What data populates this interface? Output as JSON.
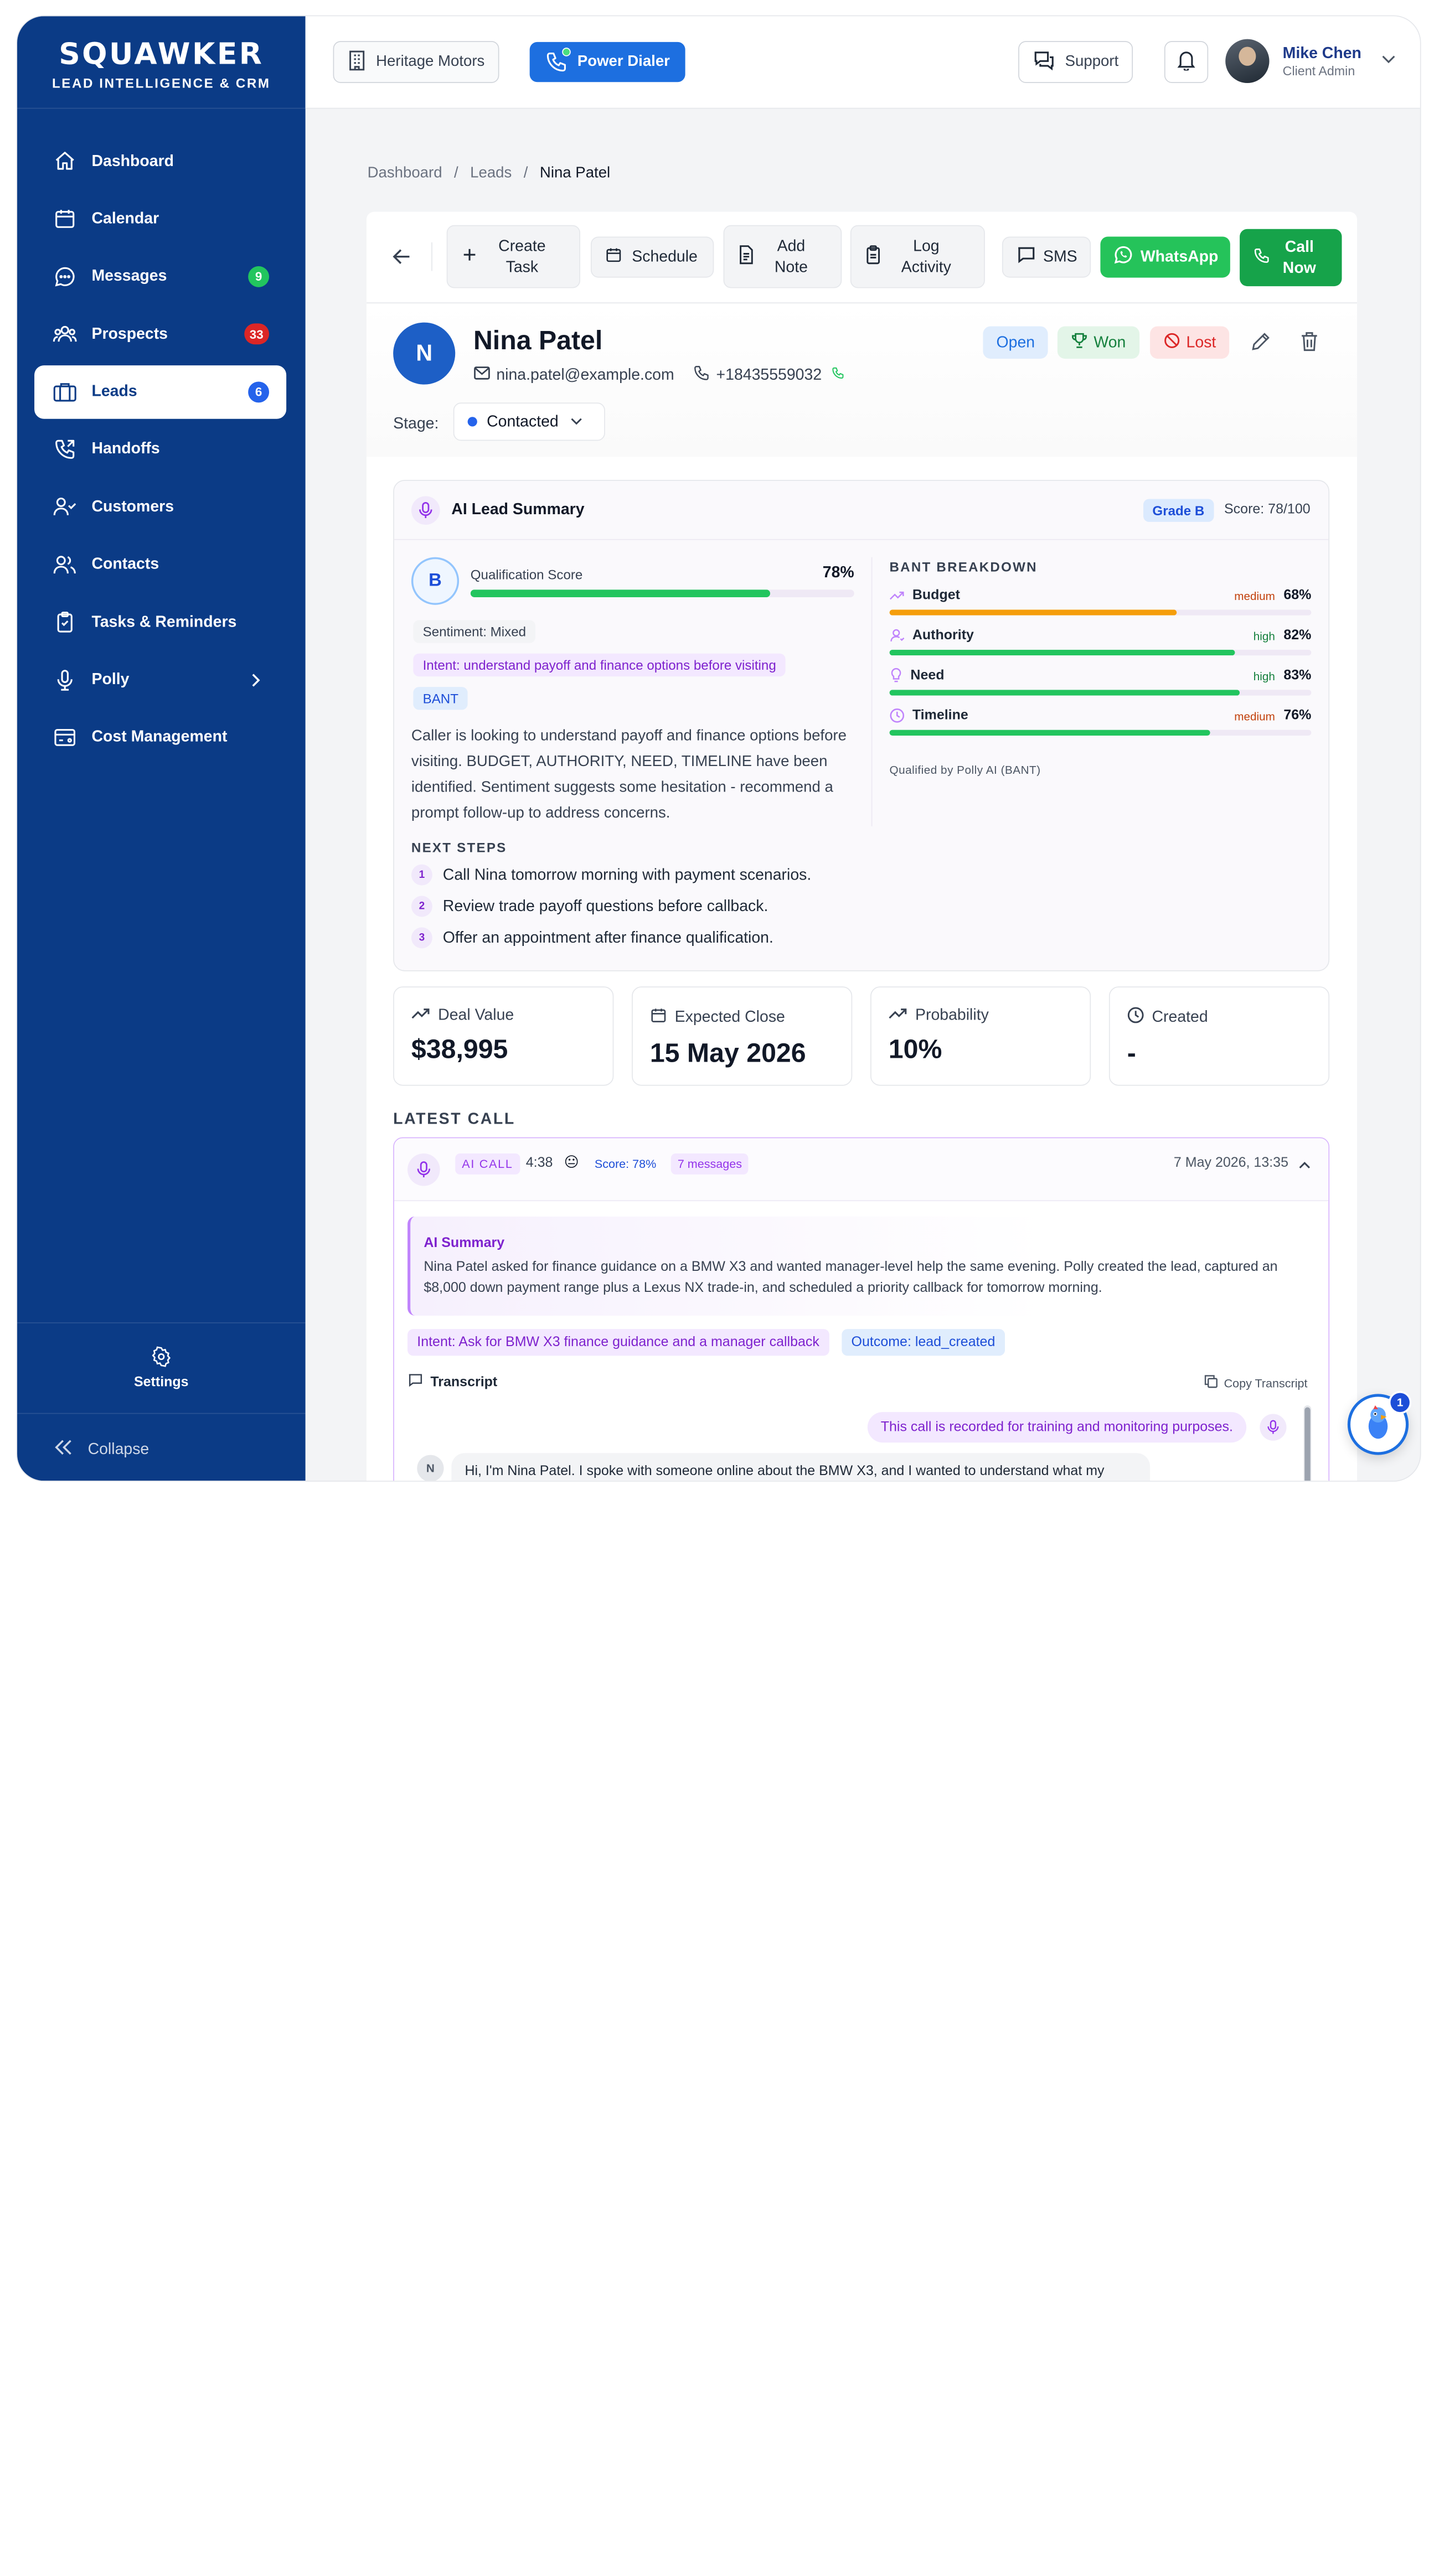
{
  "brand": {
    "title": "SQUAWKER",
    "subtitle": "LEAD INTELLIGENCE & CRM"
  },
  "sidebar": {
    "items": [
      {
        "label": "Dashboard",
        "icon": "home-icon"
      },
      {
        "label": "Calendar",
        "icon": "calendar-icon"
      },
      {
        "label": "Messages",
        "icon": "chat-icon",
        "badge": "9",
        "badge_color": "#22c55e"
      },
      {
        "label": "Prospects",
        "icon": "users-group-icon",
        "badge": "33",
        "badge_color": "#dc2626"
      },
      {
        "label": "Leads",
        "icon": "briefcase-icon",
        "badge": "6",
        "badge_color": "#2563eb",
        "active": true
      },
      {
        "label": "Handoffs",
        "icon": "phone-forward-icon"
      },
      {
        "label": "Customers",
        "icon": "user-check-icon"
      },
      {
        "label": "Contacts",
        "icon": "users-icon"
      },
      {
        "label": "Tasks & Reminders",
        "icon": "clipboard-check-icon"
      },
      {
        "label": "Polly",
        "icon": "microphone-icon"
      },
      {
        "label": "Cost Management",
        "icon": "wallet-icon"
      }
    ],
    "settings_label": "Settings",
    "collapse_label": "Collapse"
  },
  "topbar": {
    "dealership": "Heritage Motors",
    "power_dialer": "Power Dialer",
    "support": "Support",
    "user_name": "Mike Chen",
    "user_role": "Client Admin"
  },
  "breadcrumb": {
    "root": "Dashboard",
    "section": "Leads",
    "current": "Nina Patel"
  },
  "toolbar": {
    "create_task_1": "Create",
    "create_task_2": "Task",
    "schedule": "Schedule",
    "add_note_1": "Add",
    "add_note_2": "Note",
    "log_activity_1": "Log",
    "log_activity_2": "Activity",
    "sms": "SMS",
    "whatsapp": "WhatsApp",
    "call_now_1": "Call",
    "call_now_2": "Now"
  },
  "lead": {
    "initial": "N",
    "name": "Nina Patel",
    "email": "nina.patel@example.com",
    "phone": "+18435559032",
    "status_open": "Open",
    "status_won": "Won",
    "status_lost": "Lost",
    "stage_label": "Stage:",
    "stage_value": "Contacted"
  },
  "ai_summary": {
    "title": "AI Lead Summary",
    "grade_label": "Grade B",
    "score_label": "Score: 78/100",
    "grade_letter": "B",
    "qualification_label": "Qualification Score",
    "qualification_pct": "78%",
    "qualification_value": 78,
    "sentiment": "Sentiment: Mixed",
    "intent": "Intent: understand payoff and finance options before visiting",
    "framework": "BANT",
    "summary": "Caller is looking to understand payoff and finance options before visiting. BUDGET, AUTHORITY, NEED, TIMELINE have been identified. Sentiment suggests some hesitation - recommend a prompt follow-up to address concerns.",
    "next_steps_title": "NEXT STEPS",
    "next_steps": [
      {
        "num": "1",
        "text": "Call Nina tomorrow morning with payment scenarios."
      },
      {
        "num": "2",
        "text": "Review trade payoff questions before callback."
      },
      {
        "num": "3",
        "text": "Offer an appointment after finance qualification."
      }
    ],
    "bant_title": "BANT BREAKDOWN",
    "bant": [
      {
        "name": "Budget",
        "level": "medium",
        "pct": "68%",
        "value": 68,
        "color": "#f59e0b",
        "level_color": "#c2410c",
        "icon": "trend-up-icon"
      },
      {
        "name": "Authority",
        "level": "high",
        "pct": "82%",
        "value": 82,
        "color": "#22c55e",
        "level_color": "#15803d",
        "icon": "user-icon"
      },
      {
        "name": "Need",
        "level": "high",
        "pct": "83%",
        "value": 83,
        "color": "#22c55e",
        "level_color": "#15803d",
        "icon": "lightbulb-icon"
      },
      {
        "name": "Timeline",
        "level": "medium",
        "pct": "76%",
        "value": 76,
        "color": "#22c55e",
        "level_color": "#c2410c",
        "icon": "clock-icon"
      }
    ],
    "qualified_by": "Qualified by Polly AI (BANT)"
  },
  "metrics": [
    {
      "label": "Deal Value",
      "value": "$38,995",
      "icon": "trend-up-icon"
    },
    {
      "label": "Expected Close",
      "value": "15 May 2026",
      "icon": "calendar-icon"
    },
    {
      "label": "Probability",
      "value": "10%",
      "icon": "trend-up-icon"
    },
    {
      "label": "Created",
      "value": "-",
      "icon": "clock-icon"
    }
  ],
  "latest_call": {
    "title": "LATEST CALL",
    "type_chip": "AI CALL",
    "duration": "4:38",
    "sentiment_emoji": "😐",
    "score_chip": "Score: 78%",
    "messages_chip": "7 messages",
    "datetime": "7 May 2026, 13:35",
    "summary_title": "AI Summary",
    "summary_text": "Nina Patel asked for finance guidance on a BMW X3 and wanted manager-level help the same evening. Polly created the lead, captured an $8,000 down payment range plus a Lexus NX trade-in, and scheduled a priority callback for tomorrow morning.",
    "intent_tag": "Intent: Ask for BMW X3 finance guidance and a manager callback",
    "outcome_tag": "Outcome: lead_created",
    "transcript_label": "Transcript",
    "copy_label": "Copy Transcript",
    "msg_agent": "This call is recorded for training and monitoring purposes.",
    "msg_caller_initial": "N",
    "msg_caller": "Hi, I'm Nina Patel. I spoke with someone online about the BMW X3, and I wanted to understand what my monthly payment would look like before taking it."
  },
  "assistant": {
    "badge": "1"
  }
}
